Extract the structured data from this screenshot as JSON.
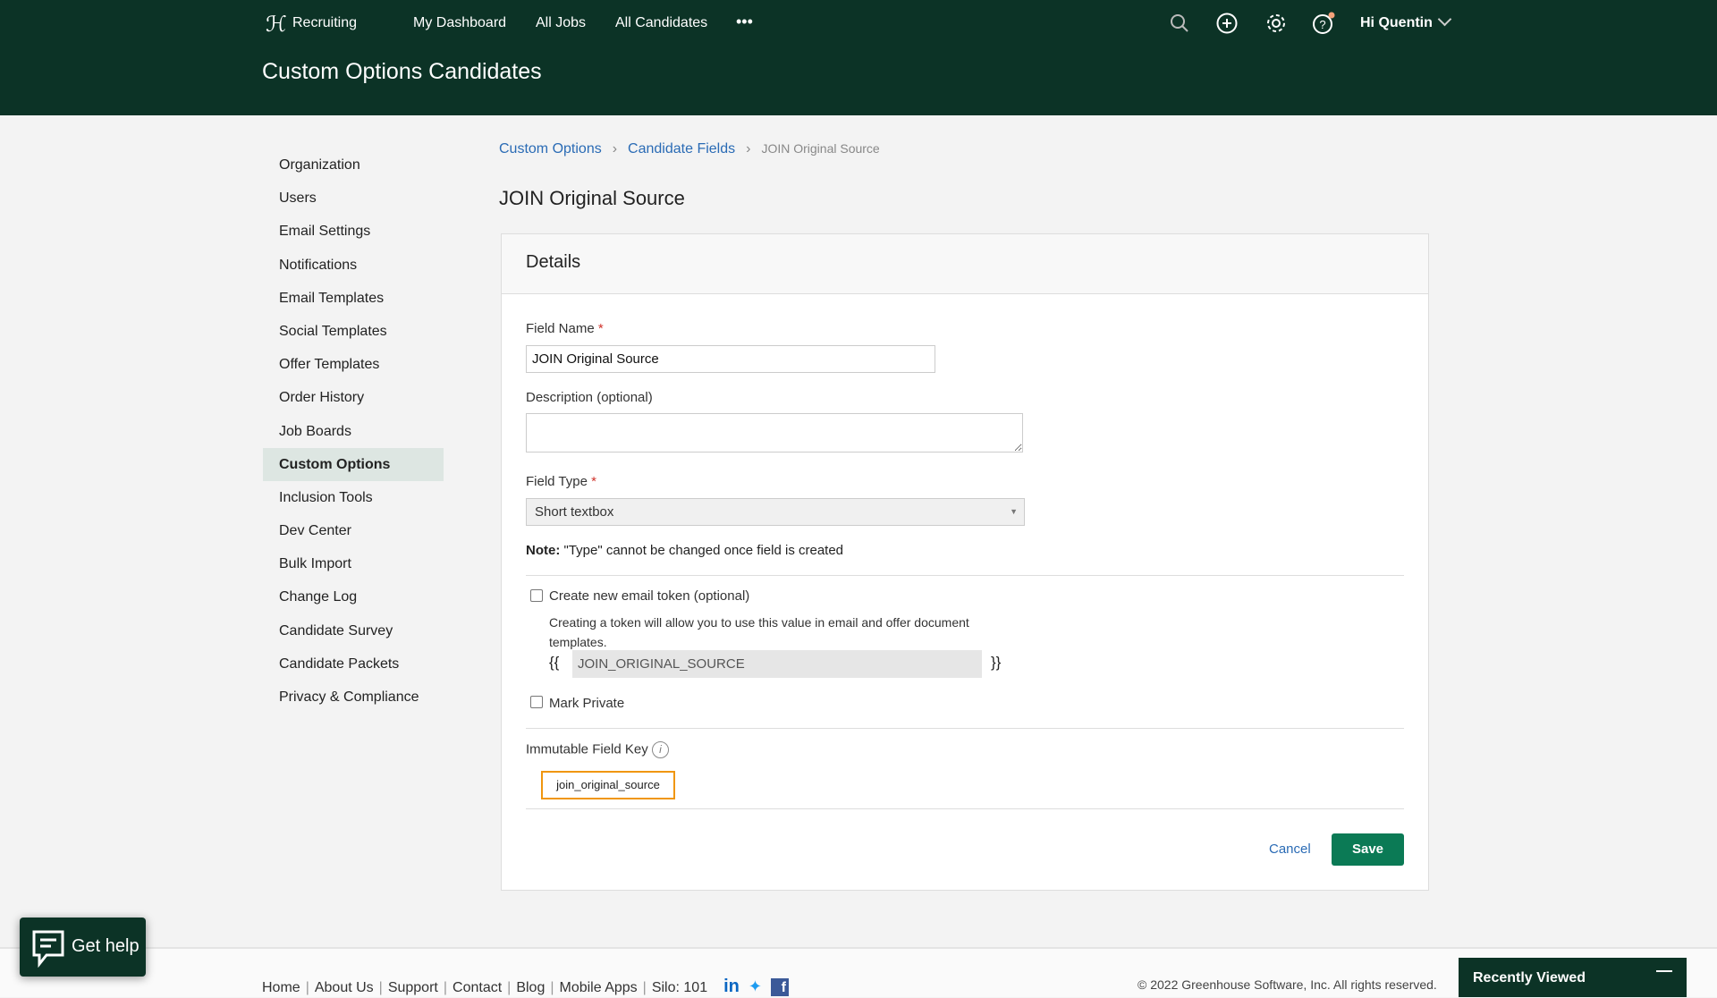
{
  "header": {
    "app": "Recruiting",
    "nav": [
      "My Dashboard",
      "All Jobs",
      "All Candidates"
    ],
    "more": "•••",
    "user": "Hi Quentin",
    "title": "Custom Options Candidates"
  },
  "sidebar": {
    "items": [
      "Organization",
      "Users",
      "Email Settings",
      "Notifications",
      "Email Templates",
      "Social Templates",
      "Offer Templates",
      "Order History",
      "Job Boards",
      "Custom Options",
      "Inclusion Tools",
      "Dev Center",
      "Bulk Import",
      "Change Log",
      "Candidate Survey",
      "Candidate Packets",
      "Privacy & Compliance"
    ],
    "active": "Custom Options"
  },
  "breadcrumb": [
    "Custom Options",
    "Candidate Fields",
    "JOIN Original Source"
  ],
  "page_title": "JOIN Original Source",
  "card": {
    "title": "Details",
    "field_name_label": "Field Name",
    "field_name_value": "JOIN Original Source",
    "required_mark": "*",
    "description_label": "Description (optional)",
    "description_value": "",
    "field_type_label": "Field Type",
    "field_type_value": "Short textbox",
    "note_label": "Note:",
    "note_text": "\"Type\" cannot be changed once field is created",
    "token_label": "Create new email token (optional)",
    "token_checked": false,
    "token_help": "Creating a token will allow you to use this value in email and offer document templates.",
    "token_open": "{{",
    "token_value": "JOIN_ORIGINAL_SOURCE",
    "token_close": "}}",
    "private_label": "Mark Private",
    "private_checked": false,
    "key_label": "Immutable Field Key",
    "key_value": "join_original_source",
    "cancel": "Cancel",
    "save": "Save"
  },
  "footer": {
    "links": [
      "Home",
      "About Us",
      "Support",
      "Contact",
      "Blog",
      "Mobile Apps"
    ],
    "silo": "Silo: 101",
    "copyright": "© 2022 Greenhouse Software, Inc. All rights reserved."
  },
  "help": "Get help",
  "recent": "Recently Viewed",
  "colors": {
    "header": "#0c3326",
    "save": "#0b7a55",
    "link": "#2a6bb5",
    "key_border": "#f0960e"
  }
}
